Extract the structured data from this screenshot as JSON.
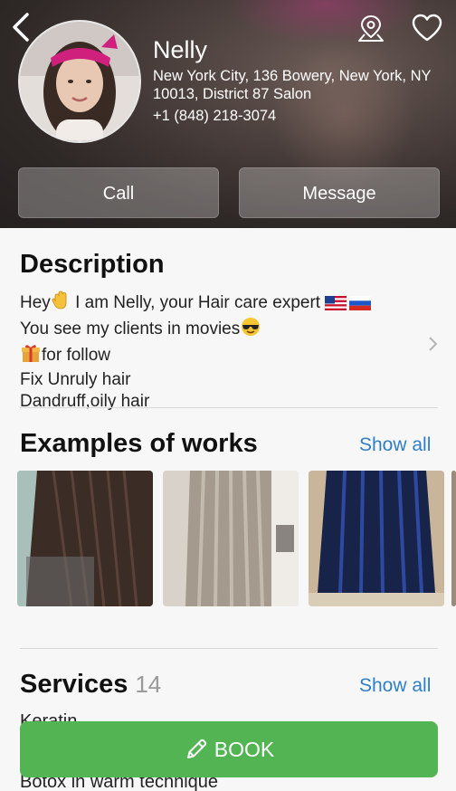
{
  "profile": {
    "name": "Nelly",
    "address": "New York City, 136 Bowery, New York, NY 10013, District 87 Salon",
    "phone": "+1 (848) 218-3074"
  },
  "actions": {
    "call_label": "Call",
    "message_label": "Message"
  },
  "description": {
    "title": "Description",
    "lines": [
      {
        "text": "Hey",
        "emoji_after": "waving-hand",
        "text2": " I am Nelly, your Hair care expert ",
        "flags": [
          "us-flag",
          "ru-flag"
        ]
      },
      {
        "text": "You see my clients in movies",
        "emoji_after": "sunglasses-face"
      },
      {
        "emoji_before": "gift",
        "text": "for follow"
      },
      {
        "text": "Fix Unruly hair"
      },
      {
        "text": "Dandruff,oily hair"
      }
    ]
  },
  "works": {
    "title": "Examples of works",
    "show_all": "Show all",
    "photos": [
      "long-dark-hair-photo",
      "long-gray-hair-photo",
      "blue-bob-hair-photo"
    ]
  },
  "services": {
    "title": "Services",
    "count": "14",
    "show_all": "Show all",
    "items": [
      "Keratin",
      "Botox in warm technique"
    ]
  },
  "book": {
    "label": "BOOK",
    "color": "#52b452"
  },
  "colors": {
    "link": "#2f7fc8",
    "accent_green": "#52b452"
  },
  "icons": [
    "back-chevron-icon",
    "location-pin-icon",
    "heart-icon",
    "chevron-right-icon",
    "pencil-icon"
  ]
}
